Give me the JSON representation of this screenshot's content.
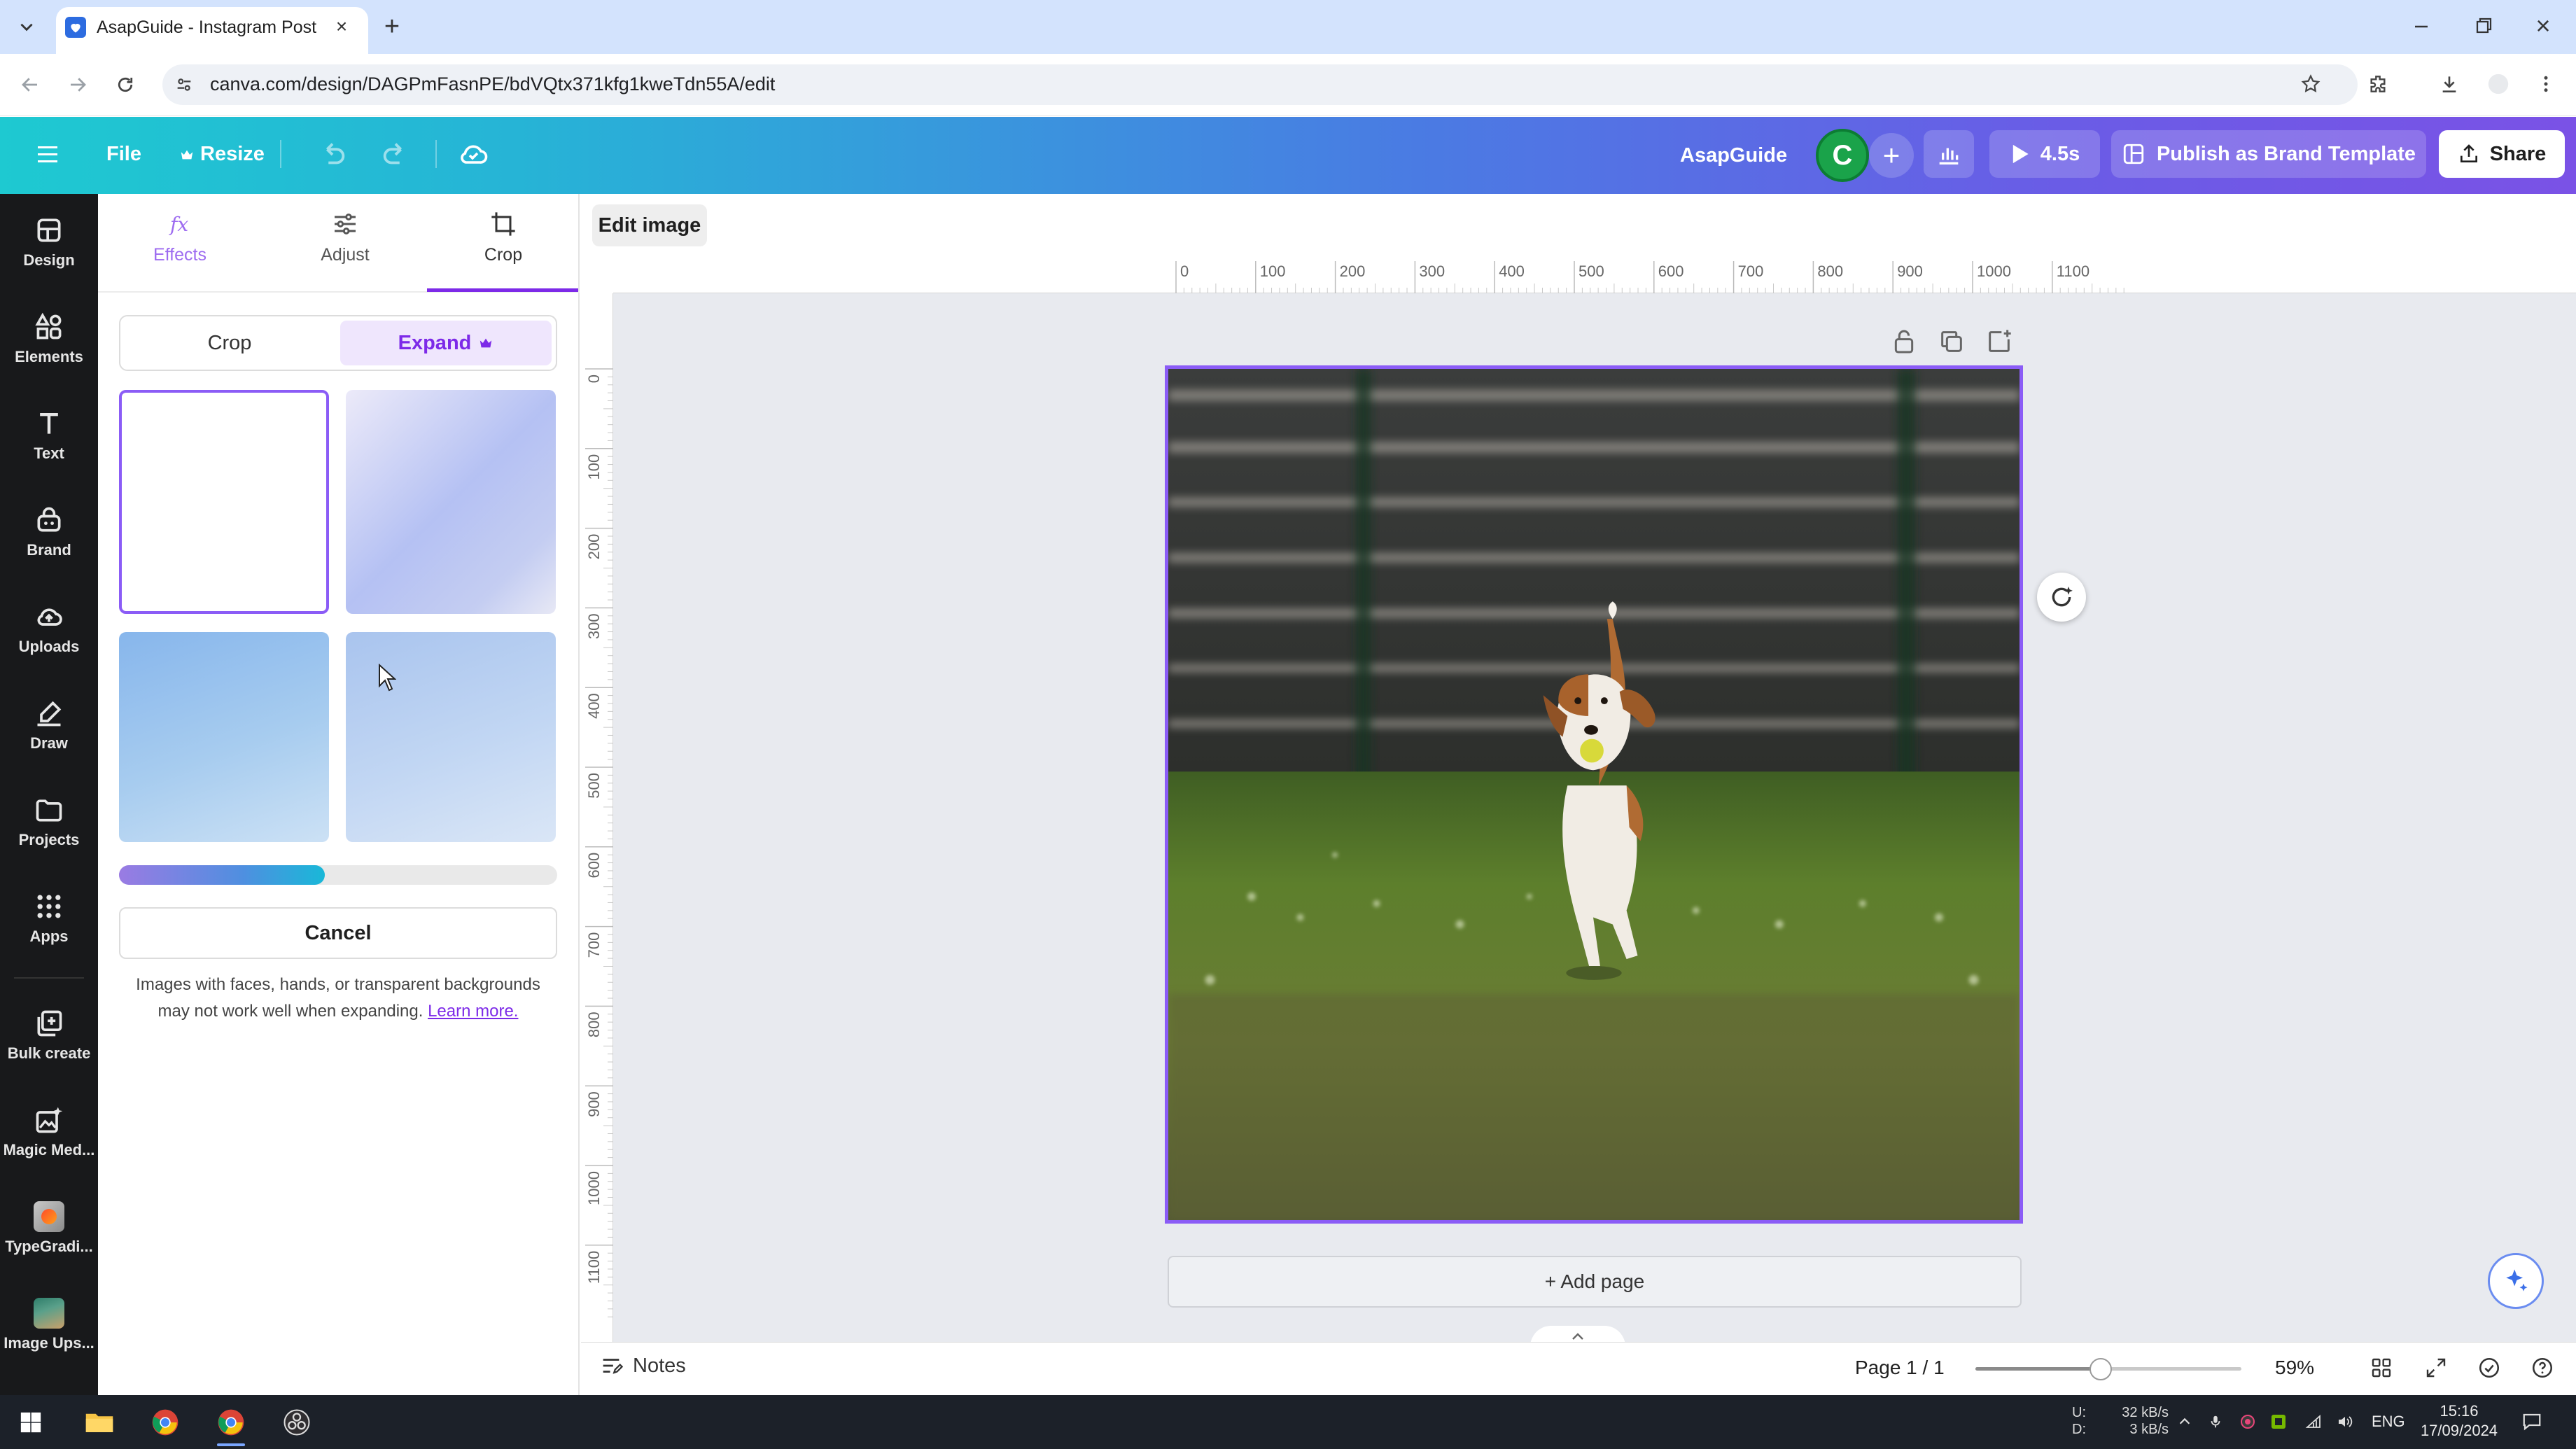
{
  "browser": {
    "tab_title": "AsapGuide - Instagram Post",
    "url": "canva.com/design/DAGPmFasnPE/bdVQtx371kfg1kweTdn55A/edit"
  },
  "header": {
    "file_label": "File",
    "resize_label": "Resize",
    "team_name": "AsapGuide",
    "avatar_initial": "C",
    "present_duration": "4.5s",
    "publish_label": "Publish as Brand Template",
    "share_label": "Share"
  },
  "rail": {
    "items": [
      {
        "label": "Design",
        "icon": "design-icon"
      },
      {
        "label": "Elements",
        "icon": "elements-icon"
      },
      {
        "label": "Text",
        "icon": "text-icon"
      },
      {
        "label": "Brand",
        "icon": "brand-icon"
      },
      {
        "label": "Uploads",
        "icon": "uploads-icon"
      },
      {
        "label": "Draw",
        "icon": "draw-icon"
      },
      {
        "label": "Projects",
        "icon": "projects-icon"
      },
      {
        "label": "Apps",
        "icon": "apps-icon"
      },
      {
        "label": "Bulk create",
        "icon": "bulk-create-icon"
      },
      {
        "label": "Magic Med...",
        "icon": "magic-media-icon"
      },
      {
        "label": "TypeGradi...",
        "icon": "typegradient-app-icon"
      },
      {
        "label": "Image Ups...",
        "icon": "image-upscaler-app-icon"
      }
    ]
  },
  "panel": {
    "tabs": [
      {
        "label": "Effects",
        "icon": "fx-icon"
      },
      {
        "label": "Adjust",
        "icon": "sliders-icon"
      },
      {
        "label": "Crop",
        "icon": "crop-icon"
      }
    ],
    "active_tab": "Crop",
    "segment": {
      "crop_label": "Crop",
      "expand_label": "Expand",
      "selected": "Expand"
    },
    "options": [
      {
        "name": "option-1",
        "selected": true
      },
      {
        "name": "option-2",
        "selected": false
      },
      {
        "name": "option-3",
        "selected": false
      },
      {
        "name": "option-4",
        "selected": false
      }
    ],
    "progress_fraction": 0.47,
    "cancel_label": "Cancel",
    "hint_text": "Images with faces, hands, or transparent backgrounds may not work well when expanding.",
    "learn_more_label": "Learn more."
  },
  "canvas": {
    "edit_image_label": "Edit image",
    "ruler_top_labels": [
      "0",
      "100",
      "200",
      "300",
      "400",
      "500",
      "600",
      "700",
      "800",
      "900",
      "1000",
      "1100"
    ],
    "ruler_left_labels": [
      "0",
      "100",
      "200",
      "300",
      "400",
      "500",
      "600",
      "700",
      "800",
      "900",
      "1000",
      "1100"
    ],
    "add_page_label": "+ Add page"
  },
  "footer": {
    "notes_label": "Notes",
    "page_count": "Page 1 / 1",
    "zoom_percent": "59%",
    "zoom_fraction": 0.47
  },
  "taskbar": {
    "net_labels": "U:\nD:",
    "net_speed": "32 kB/s\n3 kB/s",
    "language": "ENG",
    "time": "15:16",
    "date": "17/09/2024"
  },
  "colors": {
    "accent_purple": "#7d2ae8",
    "selection_border": "#8b5cf6",
    "header_gradient_start": "#1ec9d1",
    "header_gradient_end": "#7a52e6"
  }
}
